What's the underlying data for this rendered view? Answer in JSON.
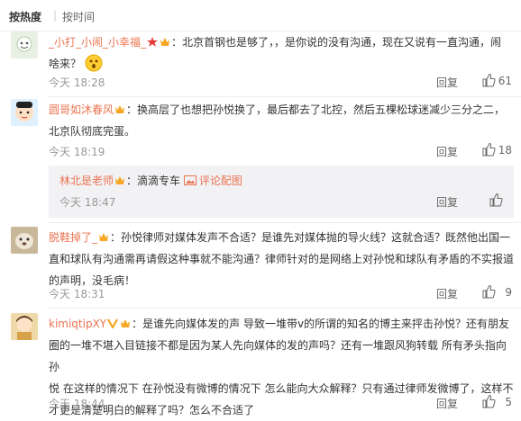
{
  "sort": {
    "hot": "按热度",
    "sep": "|",
    "time": "按时间"
  },
  "comments": [
    {
      "user": "_小打_小闹_小幸福_",
      "text_l1": "：北京首钢也是够了，，是你说的没有沟通，现在又说有一直沟通，闹",
      "text_l2": "啥来？",
      "time": "今天 18:28",
      "reply": "回复",
      "likes": "61"
    },
    {
      "user": "圆哥如沐春风",
      "text_l1": "：换高层了也想把孙悦换了，最后都去了北控，然后五棵松球迷减少三分之二，",
      "text_l2": "北京队彻底完蛋。",
      "time": "今天 18:19",
      "reply": "回复",
      "likes": "18"
    },
    {
      "user": "脱鞋掉了_",
      "text_l1": "：孙悦律师对媒体发声不合适？是谁先对媒体抛的导火线？这就合适？既然他出国一",
      "text_l2": "直和球队有沟通需再请假这种事就不能沟通？律师针对的是网络上对孙悦和球队有矛盾的不实报道",
      "text_l3": "的声明，没毛病！",
      "time": "今天 18:31",
      "reply": "回复",
      "likes": "9"
    },
    {
      "user": "kimiqtipXY",
      "text_l1": "：是谁先向媒体发的声 导致一堆带v的所谓的知名的博主来抨击孙悦？还有朋友",
      "text_l2": "圈的一堆不堪入目链接不都是因为某人先向媒体的发的声吗？还有一堆跟风狗转载 所有矛头指向孙",
      "text_l3": "悦 在这样的情况下 在孙悦没有微博的情况下 怎么能向大众解释？只有通过律师发微博了，这样不",
      "text_l4": "才更是清楚明白的解释了吗？怎么不合适了",
      "time": "今天 18:44",
      "reply": "回复",
      "likes": "5"
    }
  ],
  "sub_reply": {
    "user": "林北是老师",
    "colon": "：",
    "link": "滴滴专车",
    "link2": "评论配图",
    "time": "今天 18:47",
    "reply": "回复"
  },
  "colors": {
    "username": "#eb7350",
    "time": "#999999",
    "subbg": "#f2f2f5"
  }
}
